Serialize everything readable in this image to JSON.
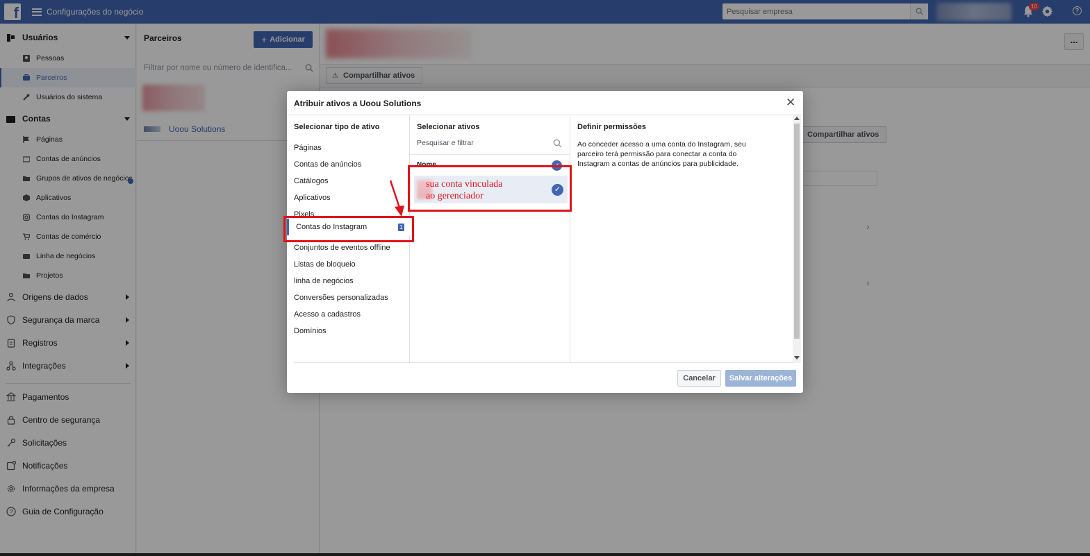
{
  "topbar": {
    "app_title": "Configurações do negócio",
    "search_placeholder": "Pesquisar empresa",
    "notification_count": "10"
  },
  "sidebar": {
    "users_section": {
      "label": "Usuários",
      "items": [
        {
          "label": "Pessoas",
          "icon": "person-icon"
        },
        {
          "label": "Parceiros",
          "icon": "briefcase-icon",
          "active": true
        },
        {
          "label": "Usuários do sistema",
          "icon": "wrench-icon"
        }
      ]
    },
    "accounts_section": {
      "label": "Contas",
      "items": [
        {
          "label": "Páginas",
          "icon": "flag-icon"
        },
        {
          "label": "Contas de anúncios",
          "icon": "ads-icon"
        },
        {
          "label": "Grupos de ativos de negócios",
          "icon": "folder-icon"
        },
        {
          "label": "Aplicativos",
          "icon": "cube-icon"
        },
        {
          "label": "Contas do Instagram",
          "icon": "instagram-icon"
        },
        {
          "label": "Contas de comércio",
          "icon": "cart-icon"
        },
        {
          "label": "Linha de negócios",
          "icon": "briefcase-icon"
        },
        {
          "label": "Projetos",
          "icon": "folder-icon"
        }
      ]
    },
    "expandable": [
      {
        "label": "Origens de dados",
        "icon": "people-icon"
      },
      {
        "label": "Segurança da marca",
        "icon": "shield-icon"
      },
      {
        "label": "Registros",
        "icon": "clipboard-icon"
      },
      {
        "label": "Integrações",
        "icon": "integrations-icon"
      }
    ],
    "bottom": [
      {
        "label": "Pagamentos",
        "icon": "bank-icon"
      },
      {
        "label": "Centro de segurança",
        "icon": "lock-icon"
      },
      {
        "label": "Solicitações",
        "icon": "key-icon"
      },
      {
        "label": "Notificações",
        "icon": "notification-icon"
      },
      {
        "label": "Informações da empresa",
        "icon": "gear-icon"
      },
      {
        "label": "Guia de Configuração",
        "icon": "help-icon"
      }
    ]
  },
  "partners": {
    "title": "Parceiros",
    "add_label": "Adicionar",
    "filter_placeholder": "Filtrar por nome ou número de identifica...",
    "partner_name": "Uoou Solutions"
  },
  "main": {
    "share_label": "Compartilhar ativos",
    "share_label_2": "Compartilhar ativos",
    "more_label": "..."
  },
  "modal": {
    "title": "Atribuir ativos a Uoou Solutions",
    "col1_title": "Selecionar tipo de ativo",
    "asset_types": [
      "Páginas",
      "Contas de anúncios",
      "Catálogos",
      "Aplicativos",
      "Pixels",
      "Contas do Instagram",
      "Conjuntos de eventos offline",
      "Listas de bloqueio",
      "linha de negócios",
      "Conversões personalizadas",
      "Acesso a cadastros",
      "Domínios"
    ],
    "active_type_index": 5,
    "active_type_count": "1",
    "col2_title": "Selecionar ativos",
    "search_placeholder": "Pesquisar e filtrar",
    "name_header": "Nome",
    "col3_title": "Definir permissões",
    "permission_text": "Ao conceder acesso a uma conta do Instagram, seu parceiro terá permissão para conectar a conta do Instagram a contas de anúncios para publicidade.",
    "cancel_label": "Cancelar",
    "save_label": "Salvar alterações"
  },
  "annotation": {
    "line1": "sua conta vinculada",
    "line2": "ao gerenciador",
    "color": "#e0131a"
  },
  "colors": {
    "brand": "#4267b2",
    "annotation_red": "#e0131a"
  }
}
